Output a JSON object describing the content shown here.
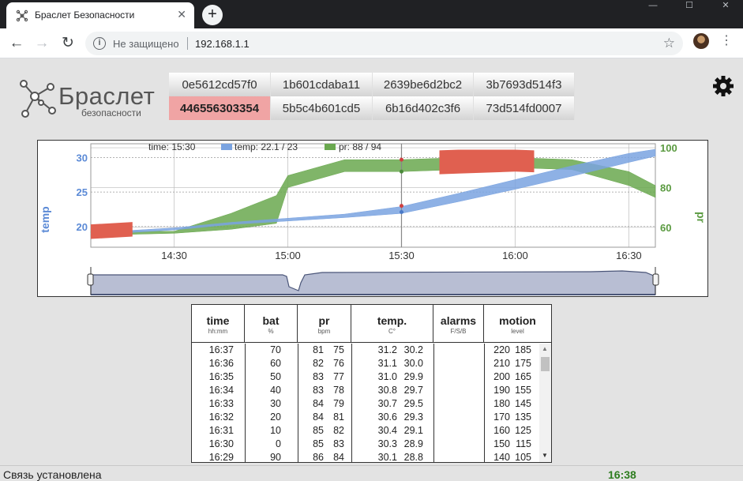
{
  "browser": {
    "tab_title": "Браслет Безопасности",
    "security_label": "Не защищено",
    "url": "192.168.1.1"
  },
  "logo": {
    "title": "Браслет",
    "subtitle": "безопасности"
  },
  "devices": [
    {
      "id": "0e5612cd57f0",
      "active": false
    },
    {
      "id": "1b601cdaba11",
      "active": false
    },
    {
      "id": "2639be6d2bc2",
      "active": false
    },
    {
      "id": "3b7693d514f3",
      "active": false
    },
    {
      "id": "446556303354",
      "active": true
    },
    {
      "id": "5b5c4b601cd5",
      "active": false
    },
    {
      "id": "6b16d402c3f6",
      "active": false
    },
    {
      "id": "73d514fd0007",
      "active": false
    }
  ],
  "colors": {
    "temp": "#7aa3e0",
    "pr": "#6aa84f",
    "alarm": "#e06050",
    "status_time": "#2e7d1f"
  },
  "chart_data": {
    "type": "area",
    "legend": {
      "time": "time: 15:30",
      "temp": "temp: 22.1 / 23",
      "pr": "pr: 88 / 94"
    },
    "x_ticks": [
      "14:30",
      "15:00",
      "15:30",
      "16:00",
      "16:30"
    ],
    "x_range": [
      "14:08",
      "16:37"
    ],
    "cursor_time": "15:30",
    "y_left": {
      "label": "temp",
      "ticks": [
        20,
        25,
        30
      ],
      "range": [
        17,
        32
      ]
    },
    "y_right": {
      "label": "pr",
      "ticks": [
        60,
        80,
        100
      ],
      "range": [
        50,
        102
      ]
    },
    "series": [
      {
        "name": "temp",
        "x": [
          "14:08",
          "14:30",
          "14:45",
          "15:00",
          "15:15",
          "15:30",
          "15:45",
          "16:00",
          "16:15",
          "16:30",
          "16:37"
        ],
        "low": [
          18.8,
          19.5,
          20.3,
          20.8,
          21.3,
          21.9,
          23.6,
          25.4,
          27.3,
          29.3,
          30.2
        ],
        "high": [
          19.1,
          19.8,
          20.6,
          21.2,
          21.8,
          22.9,
          24.8,
          26.8,
          28.8,
          30.6,
          31.2
        ]
      },
      {
        "name": "pr",
        "x": [
          "14:08",
          "14:30",
          "14:45",
          "14:57",
          "15:00",
          "15:15",
          "15:30",
          "15:45",
          "16:00",
          "16:15",
          "16:30",
          "16:37"
        ],
        "low": [
          56,
          57,
          59,
          62,
          80,
          88,
          88,
          89,
          90,
          89,
          81,
          75
        ],
        "high": [
          58,
          58,
          67,
          76,
          86,
          94,
          94,
          95,
          95,
          94,
          88,
          81
        ]
      }
    ],
    "alarms": [
      {
        "series": "temp",
        "from": "14:08",
        "to": "14:19"
      },
      {
        "series": "pr",
        "from": "15:40",
        "to": "16:05"
      }
    ]
  },
  "table": {
    "headers": [
      {
        "title": "time",
        "unit": "hh:mm"
      },
      {
        "title": "bat",
        "unit": "%"
      },
      {
        "title": "pr",
        "unit": "bpm"
      },
      {
        "title": "temp.",
        "unit": "C°"
      },
      {
        "title": "alarms",
        "unit": "F/S/B"
      },
      {
        "title": "motion",
        "unit": "level"
      }
    ],
    "rows": [
      [
        "16:37",
        "70",
        "81",
        "75",
        "31.2",
        "30.2",
        "",
        "220",
        "185"
      ],
      [
        "16:36",
        "60",
        "82",
        "76",
        "31.1",
        "30.0",
        "",
        "210",
        "175"
      ],
      [
        "16:35",
        "50",
        "83",
        "77",
        "31.0",
        "29.9",
        "",
        "200",
        "165"
      ],
      [
        "16:34",
        "40",
        "83",
        "78",
        "30.8",
        "29.7",
        "",
        "190",
        "155"
      ],
      [
        "16:33",
        "30",
        "84",
        "79",
        "30.7",
        "29.5",
        "",
        "180",
        "145"
      ],
      [
        "16:32",
        "20",
        "84",
        "81",
        "30.6",
        "29.3",
        "",
        "170",
        "135"
      ],
      [
        "16:31",
        "10",
        "85",
        "82",
        "30.4",
        "29.1",
        "",
        "160",
        "125"
      ],
      [
        "16:30",
        "0",
        "85",
        "83",
        "30.3",
        "28.9",
        "",
        "150",
        "115"
      ],
      [
        "16:29",
        "90",
        "86",
        "84",
        "30.1",
        "28.8",
        "",
        "140",
        "105"
      ]
    ]
  },
  "status": {
    "text": "Связь установлена",
    "time": "16:38"
  }
}
